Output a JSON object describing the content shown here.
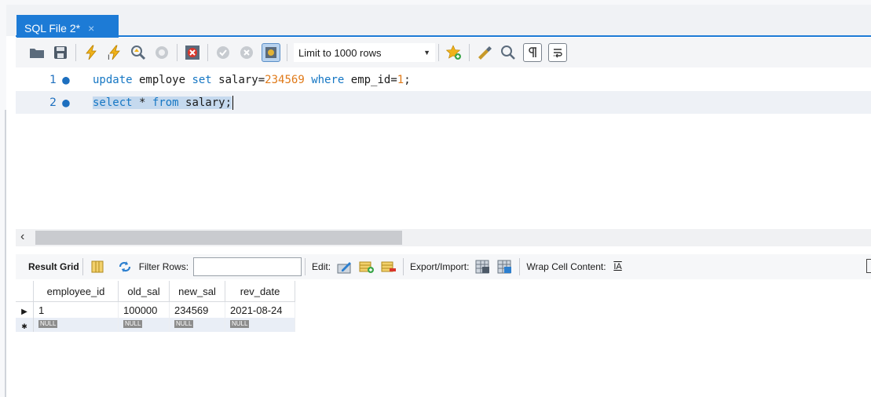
{
  "tab": {
    "title": "SQL File 2*",
    "close": "×"
  },
  "toolbar": {
    "limit_label": "Limit to 1000 rows",
    "icons": [
      "open-folder-icon",
      "save-icon",
      "execute-icon",
      "execute-current-icon",
      "explain-icon",
      "stop-icon",
      "toggle-error-icon",
      "commit-icon",
      "rollback-icon",
      "autocommit-icon",
      "add-snippet-icon",
      "beautify-icon",
      "find-icon",
      "invisible-chars-icon",
      "wrap-icon"
    ]
  },
  "editor": {
    "lines": [
      {
        "num": "1",
        "marker": "●"
      },
      {
        "num": "2",
        "marker": "●"
      }
    ],
    "line1": {
      "t1": "update",
      "t2": " employe ",
      "t3": "set",
      "t4": " salary=",
      "t5": "234569",
      "t6": " ",
      "t7": "where",
      "t8": " emp_id=",
      "t9": "1",
      "t10": ";"
    },
    "line2": {
      "t1": "select",
      "t2": " * ",
      "t3": "from",
      "t4": " salary;"
    }
  },
  "scroll": {
    "left_arrow": "‹"
  },
  "result_bar": {
    "result_grid": "Result Grid",
    "filter_rows": "Filter Rows:",
    "edit": "Edit:",
    "export_import": "Export/Import:",
    "wrap_cell": "Wrap Cell Content:",
    "wrap_icon_text": "IA"
  },
  "grid": {
    "columns": [
      "employee_id",
      "old_sal",
      "new_sal",
      "rev_date"
    ],
    "rows": [
      [
        "1",
        "100000",
        "234569",
        "2021-08-24"
      ]
    ],
    "null_text": "NULL",
    "row_pointer": "▶",
    "new_row_marker": "✱"
  },
  "colors": {
    "accent": "#1d7bd6",
    "keyword": "#1677c4",
    "number": "#e07a19"
  }
}
